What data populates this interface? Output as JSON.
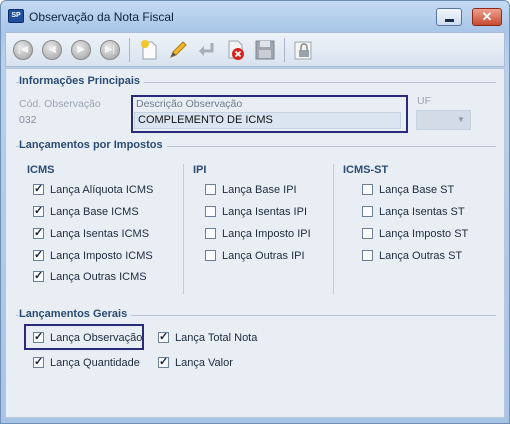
{
  "window": {
    "title": "Observação da Nota Fiscal",
    "app_icon_text": "SP"
  },
  "toolbar": {
    "buttons": [
      "first-icon",
      "previous-icon",
      "next-icon",
      "last-icon",
      "new-icon",
      "edit-icon",
      "undo-icon",
      "delete-icon",
      "save-icon",
      "lock-icon"
    ]
  },
  "principais": {
    "heading": "Informações Principais",
    "cod_label": "Cód. Observação",
    "cod_value": "032",
    "descricao_label": "Descrição Observação",
    "descricao_value": "COMPLEMENTO DE ICMS",
    "uf_label": "UF",
    "uf_value": ""
  },
  "impostos": {
    "heading": "Lançamentos por Impostos",
    "icms": {
      "title": "ICMS",
      "items": [
        {
          "label": "Lança Alíquota ICMS",
          "checked": true
        },
        {
          "label": "Lança Base ICMS",
          "checked": true
        },
        {
          "label": "Lança Isentas ICMS",
          "checked": true
        },
        {
          "label": "Lança Imposto ICMS",
          "checked": true
        },
        {
          "label": "Lança Outras ICMS",
          "checked": true
        }
      ]
    },
    "ipi": {
      "title": "IPI",
      "items": [
        {
          "label": "Lança Base IPI",
          "checked": false
        },
        {
          "label": "Lança Isentas IPI",
          "checked": false
        },
        {
          "label": "Lança Imposto IPI",
          "checked": false
        },
        {
          "label": "Lança Outras IPI",
          "checked": false
        }
      ]
    },
    "icmsst": {
      "title": "ICMS-ST",
      "items": [
        {
          "label": "Lança Base ST",
          "checked": false
        },
        {
          "label": "Lança Isentas ST",
          "checked": false
        },
        {
          "label": "Lança Imposto ST",
          "checked": false
        },
        {
          "label": "Lança Outras ST",
          "checked": false
        }
      ]
    }
  },
  "gerais": {
    "heading": "Lançamentos Gerais",
    "items": [
      {
        "label": "Lança Observação",
        "checked": true
      },
      {
        "label": "Lança Total Nota",
        "checked": true
      },
      {
        "label": "Lança Quantidade",
        "checked": true
      },
      {
        "label": "Lança Valor",
        "checked": true
      }
    ]
  }
}
